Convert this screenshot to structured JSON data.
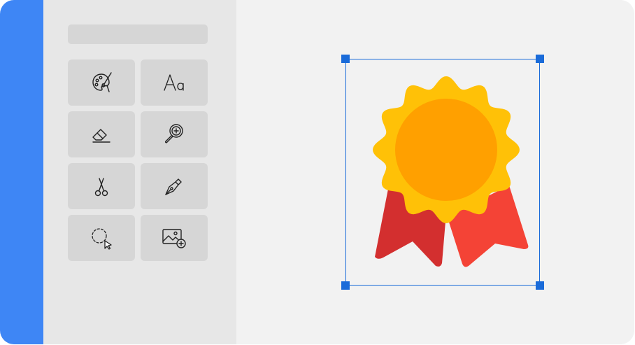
{
  "app": {
    "accent_color": "#3e86f5",
    "panel_color": "#e7e7e7",
    "canvas_color": "#f2f2f2"
  },
  "toolbar": {
    "tools": [
      {
        "name": "palette-icon",
        "selected": false
      },
      {
        "name": "text-icon",
        "label": "Aa",
        "selected": false
      },
      {
        "name": "eraser-icon",
        "selected": false
      },
      {
        "name": "zoom-icon",
        "selected": false
      },
      {
        "name": "scissors-icon",
        "selected": false
      },
      {
        "name": "pen-icon",
        "selected": false
      },
      {
        "name": "lasso-select-icon",
        "selected": false
      },
      {
        "name": "add-image-icon",
        "selected": false
      }
    ]
  },
  "canvas": {
    "selected_object": "medal-icon",
    "selection_color": "#1a6bd9",
    "medal_colors": {
      "rosette": "#ffc107",
      "center": "#ffa000",
      "ribbon_left": "#d32f2f",
      "ribbon_right": "#f44336"
    }
  }
}
